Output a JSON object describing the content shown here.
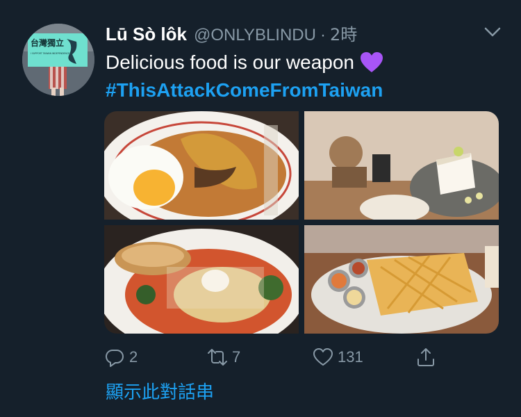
{
  "tweet": {
    "display_name": "Lū Sò lôk",
    "handle": "@ONLYBLINDU",
    "separator": "·",
    "time": "2時",
    "text_line1": "Delicious food is our weapon",
    "emoji": "purple-heart",
    "hashtag": "#ThisAttackComeFromTaiwan",
    "avatar_sign_text": "台灣獨立",
    "avatar_sign_subtext": "I SUPPORT TAIWAN INDEPENDENCE"
  },
  "media": [
    {
      "name": "photo-rice-noodle-chicken-egg"
    },
    {
      "name": "photo-cake-dessert-table"
    },
    {
      "name": "photo-tomato-pasta-bread"
    },
    {
      "name": "photo-french-fries-sauces"
    }
  ],
  "actions": {
    "reply_count": "2",
    "retweet_count": "7",
    "like_count": "131"
  },
  "thread_link": "顯示此對話串",
  "colors": {
    "background": "#15202b",
    "accent": "#1da1f2",
    "muted": "#8899a6"
  }
}
